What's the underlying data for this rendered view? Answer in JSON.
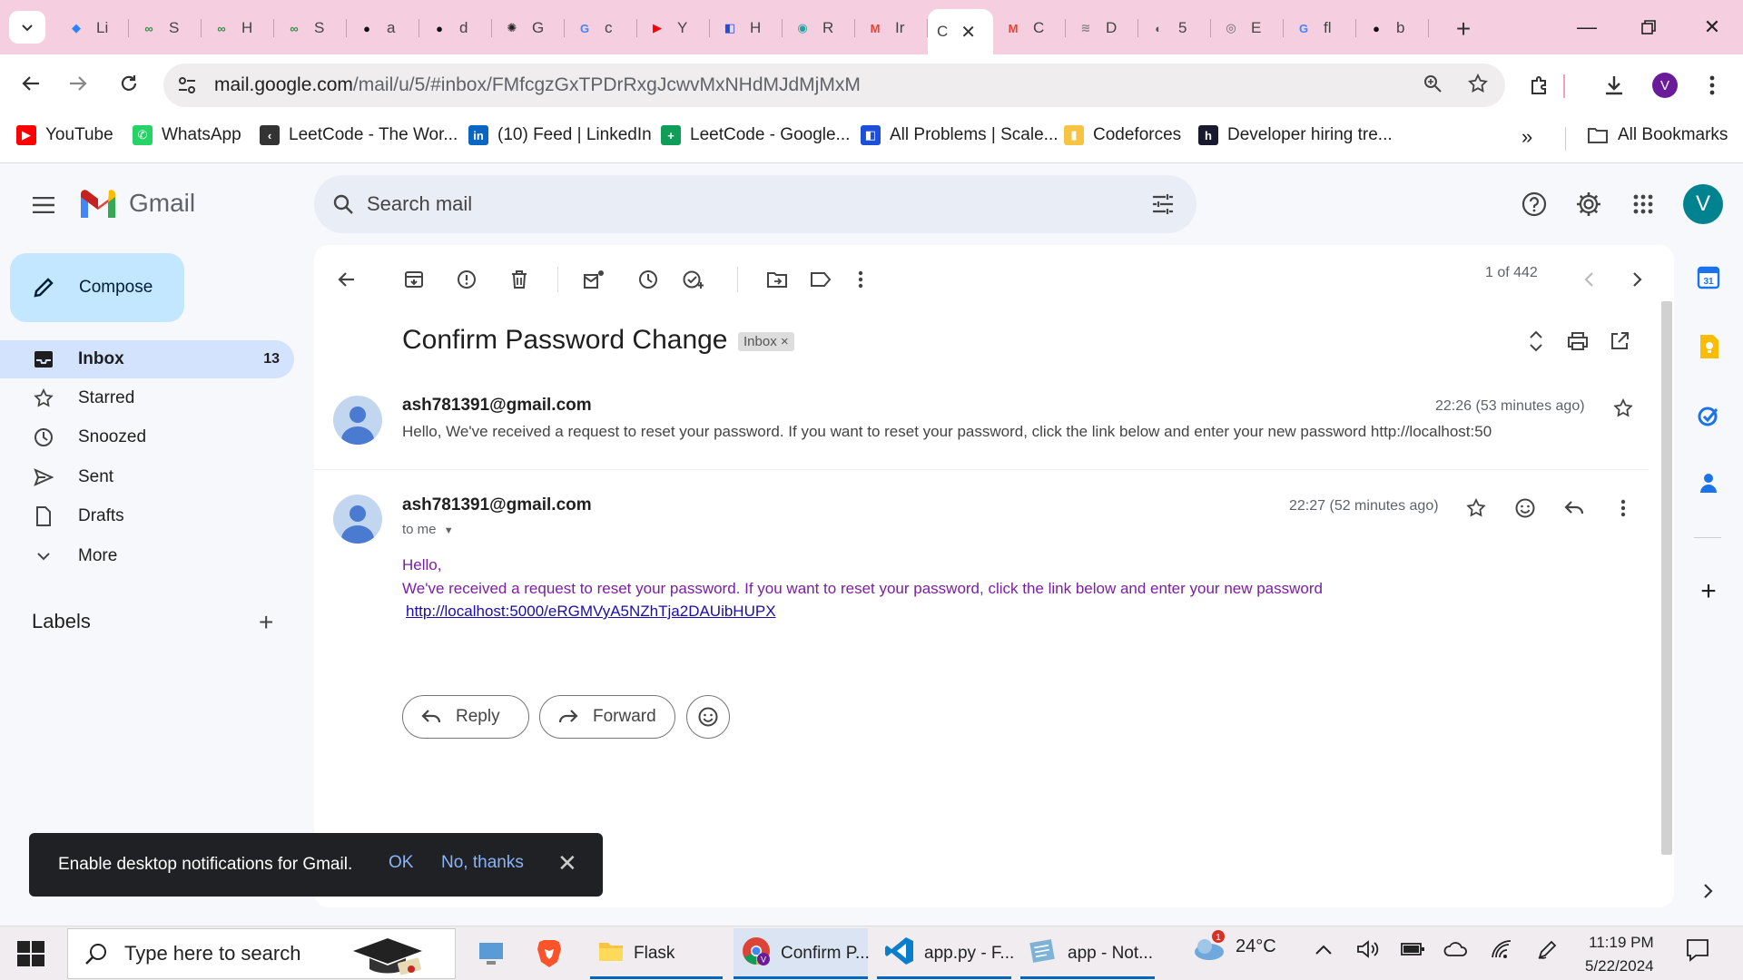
{
  "browser": {
    "tabs": [
      {
        "title": "Li",
        "icon": "jira-icon",
        "color": "#2684ff"
      },
      {
        "title": "S",
        "icon": "geeksforgeeks-icon",
        "color": "#2f8d46"
      },
      {
        "title": "H",
        "icon": "geeksforgeeks-icon",
        "color": "#2f8d46"
      },
      {
        "title": "S",
        "icon": "geeksforgeeks-icon",
        "color": "#2f8d46"
      },
      {
        "title": "a",
        "icon": "github-icon",
        "color": "#111"
      },
      {
        "title": "d",
        "icon": "github-icon",
        "color": "#111"
      },
      {
        "title": "G",
        "icon": "chatgpt-icon",
        "color": "#222"
      },
      {
        "title": "c",
        "icon": "google-icon",
        "color": "#4285f4"
      },
      {
        "title": "Y",
        "icon": "youtube-icon",
        "color": "#ff0000"
      },
      {
        "title": "H",
        "icon": "scaler-icon",
        "color": "#1e4fd9"
      },
      {
        "title": "R",
        "icon": "codechef-icon",
        "color": "#20a39e"
      },
      {
        "title": "Ir",
        "icon": "gmail-icon",
        "color": "#ea4335"
      },
      {
        "title": "C",
        "icon": "active-tab",
        "color": "#ffffff",
        "active": true
      },
      {
        "title": "C",
        "icon": "gmail-icon",
        "color": "#ea4335"
      },
      {
        "title": "D",
        "icon": "database-icon",
        "color": "#888"
      },
      {
        "title": "5",
        "icon": "globe-icon",
        "color": "#555"
      },
      {
        "title": "E",
        "icon": "app-icon",
        "color": "#666"
      },
      {
        "title": "fl",
        "icon": "google-icon",
        "color": "#4285f4"
      },
      {
        "title": "b",
        "icon": "github-icon",
        "color": "#111"
      }
    ],
    "url_host": "mail.google.com",
    "url_path": "/mail/u/5/#inbox/FMfcgzGxTPDrRxgJcwvMxNHdMJdMjMxM",
    "profile_initial": "V",
    "bookmarks": [
      {
        "label": "YouTube",
        "icon": "youtube-icon",
        "color": "#ff0000"
      },
      {
        "label": "WhatsApp",
        "icon": "whatsapp-icon",
        "color": "#25d366"
      },
      {
        "label": "LeetCode - The Wor...",
        "icon": "leetcode-icon",
        "color": "#333"
      },
      {
        "label": "(10) Feed | LinkedIn",
        "icon": "linkedin-icon",
        "color": "#0a66c2"
      },
      {
        "label": "LeetCode - Google...",
        "icon": "sheets-icon",
        "color": "#0f9d58"
      },
      {
        "label": "All Problems | Scale...",
        "icon": "scaler-icon",
        "color": "#1e4fd9"
      },
      {
        "label": "Codeforces",
        "icon": "codeforces-icon",
        "color": "#f6c343"
      },
      {
        "label": "Developer hiring tre...",
        "icon": "hackerrank-icon",
        "color": "#1a1a2e"
      }
    ],
    "all_bookmarks_label": "All Bookmarks"
  },
  "gmail": {
    "logo_text": "Gmail",
    "search_placeholder": "Search mail",
    "avatar_initial": "V",
    "compose_label": "Compose",
    "nav": [
      {
        "label": "Inbox",
        "count": "13",
        "icon": "inbox-icon",
        "active": true
      },
      {
        "label": "Starred",
        "count": "",
        "icon": "star-icon"
      },
      {
        "label": "Snoozed",
        "count": "",
        "icon": "clock-icon"
      },
      {
        "label": "Sent",
        "count": "",
        "icon": "send-icon"
      },
      {
        "label": "Drafts",
        "count": "",
        "icon": "draft-icon"
      },
      {
        "label": "More",
        "count": "",
        "icon": "chevron-down-icon"
      }
    ],
    "labels_heading": "Labels",
    "pager": "1 of 442",
    "subject": "Confirm Password Change",
    "chip": "Inbox",
    "messages": [
      {
        "from": "ash781391@gmail.com",
        "time": "22:26 (53 minutes ago)",
        "snippet": "Hello, We've received a request to reset your password. If you want to reset your password, click the link below and enter your new password http://localhost:50"
      },
      {
        "from": "ash781391@gmail.com",
        "time": "22:27 (52 minutes ago)",
        "to": "to me",
        "greeting": "Hello,",
        "body": "We've received a request to reset your password. If you want to reset your password, click the link below and enter your new password",
        "link": "http://localhost:5000/eRGMVyA5NZhTja2DAUibHUPX"
      }
    ],
    "reply_label": "Reply",
    "forward_label": "Forward",
    "toast": {
      "message": "Enable desktop notifications for Gmail.",
      "ok": "OK",
      "no": "No, thanks"
    }
  },
  "taskbar": {
    "search_placeholder": "Type here to search",
    "apps": [
      {
        "label": "Flask",
        "icon": "folder-icon"
      },
      {
        "label": "Confirm P...",
        "icon": "chrome-icon"
      },
      {
        "label": "app.py - F...",
        "icon": "vscode-icon"
      },
      {
        "label": "app - Not...",
        "icon": "notepad-icon"
      }
    ],
    "weather": "24°C",
    "weather_badge": "1",
    "time": "11:19 PM",
    "date": "5/22/2024"
  }
}
